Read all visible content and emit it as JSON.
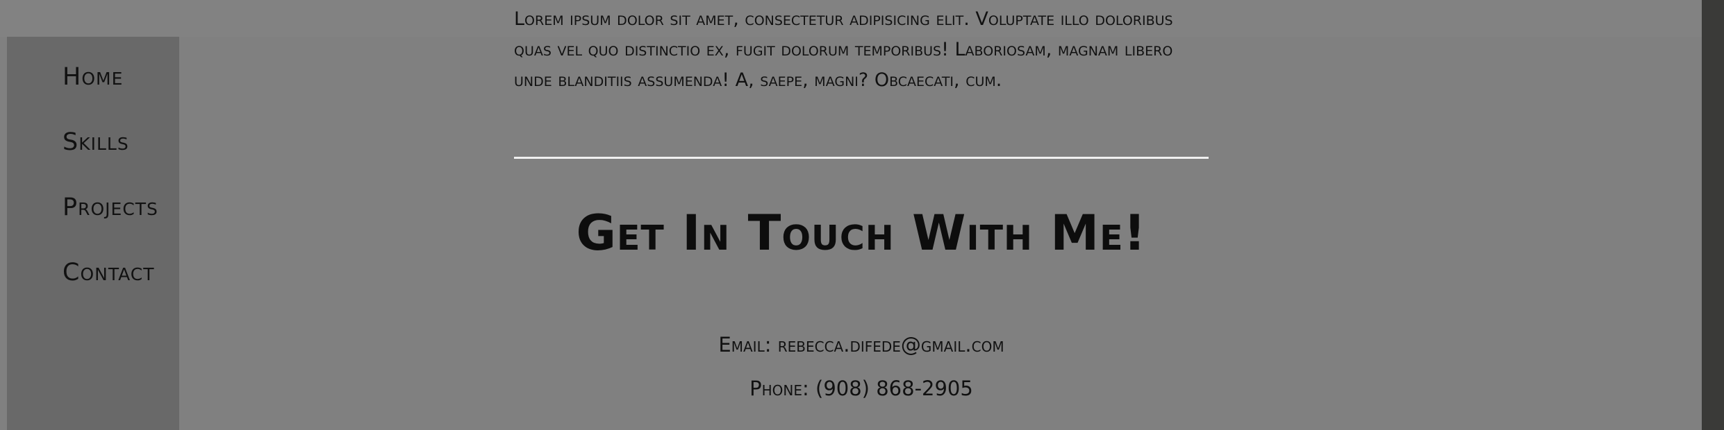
{
  "nav": {
    "items": [
      "Home",
      "Skills",
      "Projects",
      "Contact"
    ]
  },
  "about": {
    "text": "Lorem ipsum dolor sit amet, consectetur adipisicing elit. Voluptate illo doloribus quas vel quo distinctio ex, fugit dolorum temporibus! Laboriosam, magnam libero unde blanditiis assumenda! A, saepe, magni? Obcaecati, cum."
  },
  "contact": {
    "heading": "Get In Touch With Me!",
    "email_label": "Email:",
    "email": "rebecca.difede@gmail.com",
    "phone_label": "Phone:",
    "phone": "(908) 868-2905"
  },
  "colors": {
    "background": "#808080",
    "sidebar": "#696969",
    "divider": "#f0f0f0",
    "text": "#111111"
  }
}
